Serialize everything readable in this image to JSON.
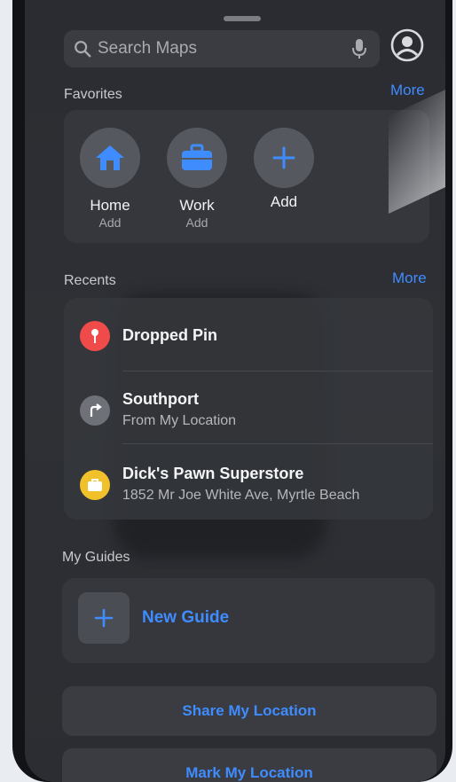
{
  "search": {
    "placeholder": "Search Maps"
  },
  "favorites": {
    "title": "Favorites",
    "more": "More",
    "items": [
      {
        "label": "Home",
        "sub": "Add",
        "icon": "house-icon"
      },
      {
        "label": "Work",
        "sub": "Add",
        "icon": "briefcase-icon"
      },
      {
        "label": "Add",
        "sub": "",
        "icon": "plus-icon"
      }
    ]
  },
  "recents": {
    "title": "Recents",
    "more": "More",
    "items": [
      {
        "title": "Dropped Pin",
        "sub": "",
        "icon": "pin-icon",
        "color": "#ef4b4b"
      },
      {
        "title": "Southport",
        "sub": "From My Location",
        "icon": "directions-arrow-icon",
        "color": "#6e7177"
      },
      {
        "title": "Dick's Pawn Superstore",
        "sub": "1852 Mr Joe White Ave, Myrtle Beach",
        "icon": "bag-icon",
        "color": "#f0c12b"
      }
    ]
  },
  "guides": {
    "title": "My Guides",
    "new_label": "New Guide"
  },
  "actions": {
    "share": "Share My Location",
    "mark": "Mark My Location"
  },
  "colors": {
    "accent": "#3f8cff",
    "background": "#2e3035",
    "card": "#35373c"
  }
}
